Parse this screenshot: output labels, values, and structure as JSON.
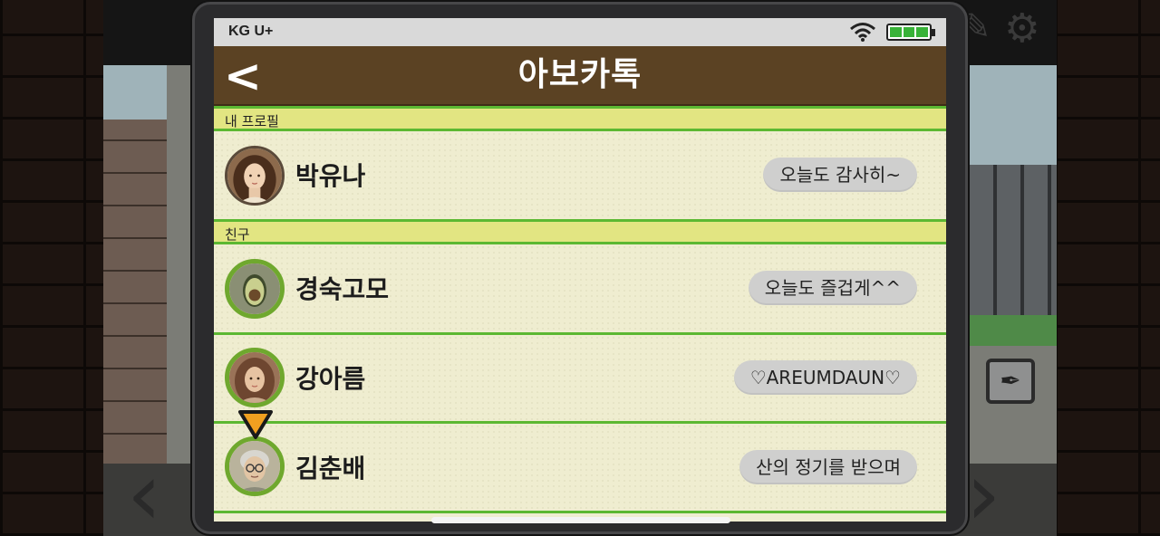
{
  "status_bar": {
    "carrier": "KG U+",
    "wifi_icon": "wifi-icon",
    "battery_icon": "battery-icon"
  },
  "app_bar": {
    "title": "아보카톡",
    "back_icon": "chevron-left-icon"
  },
  "sections": {
    "my_profile": {
      "label": "내 프로필"
    },
    "friends": {
      "label": "친구"
    }
  },
  "my_profile": {
    "name": "박유나",
    "status": "오늘도 감사히~",
    "avatar": "woman-portrait-avatar"
  },
  "friends": [
    {
      "name": "경숙고모",
      "status": "오늘도 즐겁게^^",
      "avatar": "avocado-avatar"
    },
    {
      "name": "강아름",
      "status": "♡AREUMDAUN♡",
      "avatar": "young-woman-avatar"
    },
    {
      "name": "김춘배",
      "status": "산의 정기를 받으며",
      "avatar": "elderly-man-avatar"
    }
  ],
  "colors": {
    "app_bar": "#5b4223",
    "section_header": "#e2e582",
    "divider": "#5cb832",
    "pill": "#cfcfce",
    "marker": "#f0a020"
  }
}
